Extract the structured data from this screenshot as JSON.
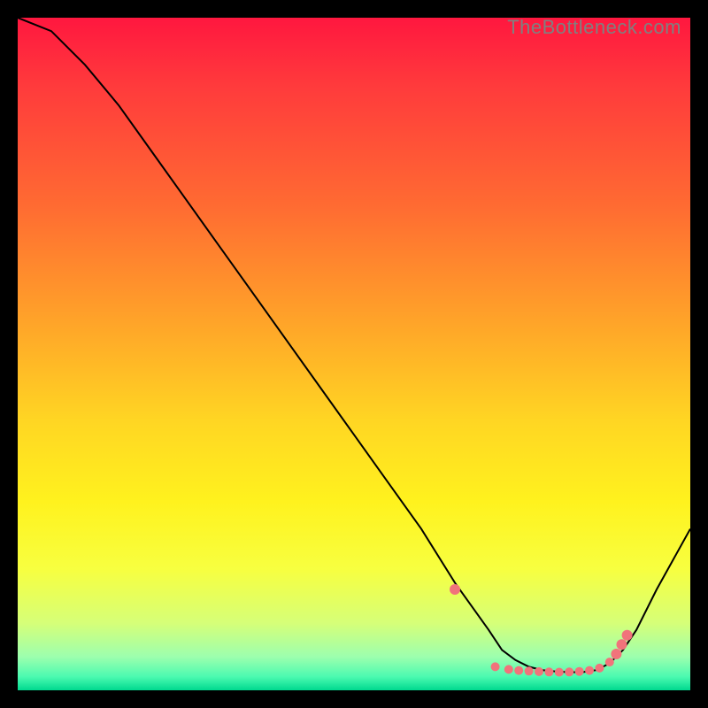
{
  "watermark": "TheBottleneck.com",
  "chart_data": {
    "type": "line",
    "title": "",
    "xlabel": "",
    "ylabel": "",
    "xlim": [
      0,
      100
    ],
    "ylim": [
      0,
      100
    ],
    "grid": false,
    "x": [
      0,
      5,
      10,
      15,
      20,
      25,
      30,
      35,
      40,
      45,
      50,
      55,
      60,
      65,
      70,
      72,
      74,
      76,
      78,
      80,
      82,
      84,
      86,
      88,
      90,
      92,
      95,
      100
    ],
    "values": [
      100,
      98,
      93,
      87,
      80,
      73,
      66,
      59,
      52,
      45,
      38,
      31,
      24,
      16,
      9,
      6,
      4.5,
      3.5,
      3,
      2.8,
      2.7,
      2.7,
      3,
      4,
      6,
      9,
      15,
      24
    ],
    "dots": {
      "x": [
        65,
        71,
        73,
        74.5,
        76,
        77.5,
        79,
        80.5,
        82,
        83.5,
        85,
        86.5,
        88,
        89,
        89.8,
        90.6
      ],
      "values": [
        15,
        3.5,
        3.1,
        2.95,
        2.85,
        2.78,
        2.72,
        2.7,
        2.72,
        2.8,
        2.95,
        3.3,
        4.2,
        5.4,
        6.8,
        8.2
      ]
    },
    "colors": {
      "line": "#000000",
      "dot": "#f1737b"
    },
    "background_gradient": [
      "#ff173f",
      "#ff6b32",
      "#ffd623",
      "#f7ff40",
      "#4bfab0",
      "#00d98f"
    ]
  }
}
